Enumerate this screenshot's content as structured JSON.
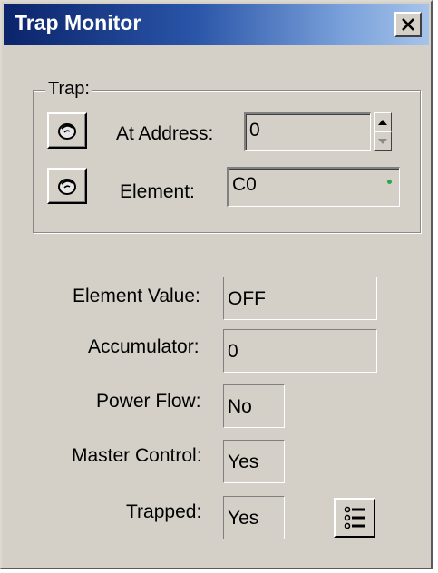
{
  "window": {
    "title": "Trap Monitor",
    "close_symbol": "X"
  },
  "trap_group": {
    "label": "Trap:",
    "address_label": "At Address:",
    "address_value": "0",
    "element_label": "Element:",
    "element_value": "C0",
    "address_button_icon": "pick-icon",
    "element_button_icon": "pick-icon"
  },
  "status": {
    "element_value_label": "Element Value:",
    "element_value": "OFF",
    "accumulator_label": "Accumulator:",
    "accumulator_value": "0",
    "power_flow_label": "Power Flow:",
    "power_flow_value": "No",
    "master_control_label": "Master Control:",
    "master_control_value": "Yes",
    "trapped_label": "Trapped:",
    "trapped_value": "Yes",
    "list_button_icon": "list-icon"
  },
  "colors": {
    "title_start": "#0b246b",
    "title_end": "#a6c3ea",
    "face": "#d4d0c8",
    "indicator": "#2ea44f"
  }
}
